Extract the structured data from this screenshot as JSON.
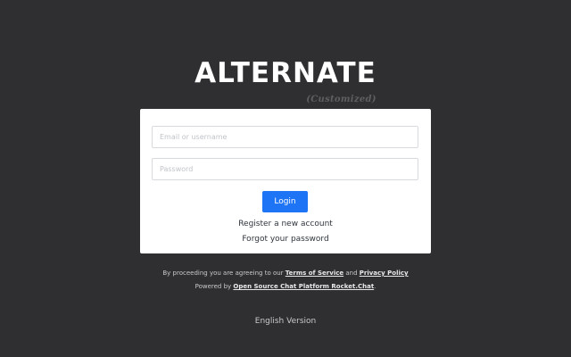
{
  "logo": {
    "text": "ALTERNATE",
    "tagline": "(Customized)"
  },
  "form": {
    "username_placeholder": "Email or username",
    "password_placeholder": "Password",
    "login_label": "Login",
    "register_label": "Register a new account",
    "forgot_label": "Forgot your password"
  },
  "legal": {
    "prefix": "By proceeding you are agreeing to our ",
    "terms": "Terms of Service",
    "and": " and ",
    "privacy": "Privacy Policy",
    "powered_prefix": "Powered by ",
    "powered_link": "Open Source Chat Platform Rocket.Chat",
    "powered_suffix": "."
  },
  "language_link": "English Version",
  "colors": {
    "background": "#2f2f31",
    "accent": "#1d74f5",
    "card": "#ffffff"
  }
}
